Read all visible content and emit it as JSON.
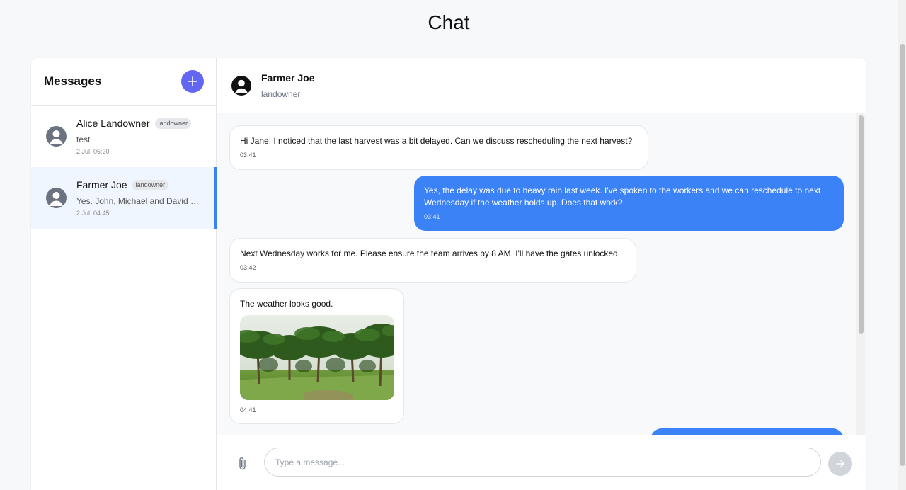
{
  "page": {
    "title": "Chat"
  },
  "sidebar": {
    "title": "Messages",
    "new_chat_icon": "plus-icon",
    "conversations": [
      {
        "name": "Alice Landowner",
        "role": "landowner",
        "preview": "test",
        "time": "2 Jul, 05:20",
        "active": false
      },
      {
        "name": "Farmer Joe",
        "role": "landowner",
        "preview": "Yes. John, Michael and David will be there",
        "time": "2 Jul, 04:45",
        "active": true
      }
    ]
  },
  "chat": {
    "header": {
      "name": "Farmer Joe",
      "role": "landowner"
    },
    "messages": [
      {
        "direction": "incoming",
        "text": "Hi Jane, I noticed that the last harvest was a bit delayed. Can we discuss rescheduling the next harvest?",
        "time": "03:41"
      },
      {
        "direction": "outgoing",
        "text": "Yes, the delay was due to heavy rain last week. I've spoken to the workers and we can reschedule to next Wednesday if the weather holds up. Does that work?",
        "time": "03:41"
      },
      {
        "direction": "incoming",
        "text": "Next Wednesday works for me. Please ensure the team arrives by 8 AM. I'll have the gates unlocked.",
        "time": "03:42"
      },
      {
        "direction": "incoming",
        "text": "The weather looks good.",
        "image": "oil-palm-plantation-photo",
        "time": "04:41"
      },
      {
        "direction": "outgoing",
        "text": "",
        "time": ""
      }
    ],
    "composer": {
      "placeholder": "Type a message...",
      "value": "",
      "attach_icon": "paperclip-icon",
      "send_icon": "arrow-right-icon"
    }
  },
  "colors": {
    "accent": "#6366f1",
    "outgoing_bubble": "#3b82f6",
    "active_conversation_bg": "#eff6ff",
    "send_button_disabled": "#d1d5db"
  }
}
